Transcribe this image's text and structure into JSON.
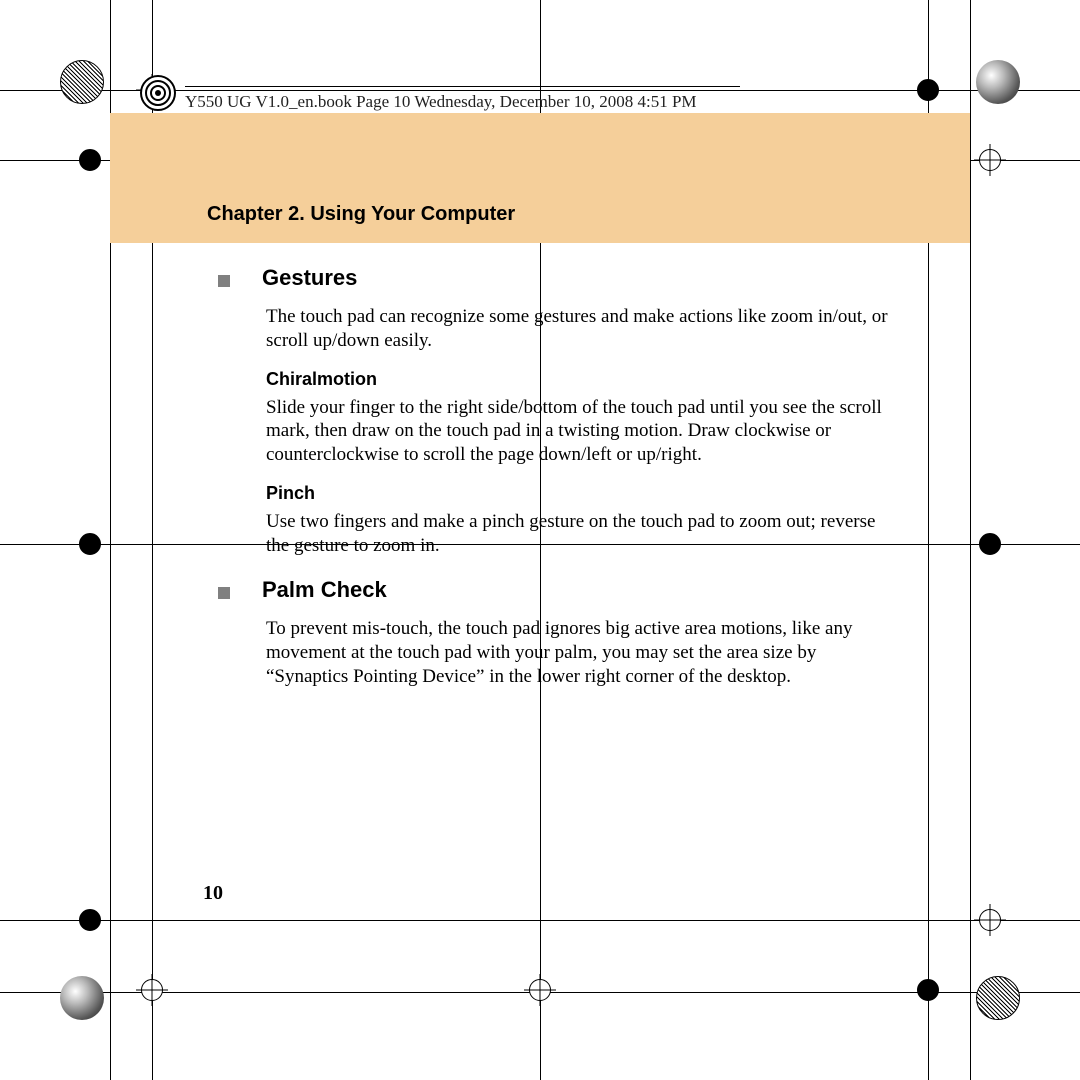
{
  "slip": "Y550 UG V1.0_en.book  Page 10  Wednesday, December 10, 2008  4:51 PM",
  "banner_title": "Chapter 2. Using Your Computer",
  "sections": {
    "gestures": {
      "title": "Gestures",
      "intro": "The touch pad can recognize some gestures and make actions like zoom in/out, or scroll up/down easily.",
      "sub1_title": "Chiralmotion",
      "sub1_body": "Slide your finger to the right side/bottom of the touch pad until you see the scroll mark, then draw on the touch pad in a twisting motion. Draw clockwise or counterclockwise to scroll the page down/left or up/right.",
      "sub2_title": "Pinch",
      "sub2_body": "Use two fingers and make a pinch gesture on the touch pad to zoom out; reverse the gesture to zoom in."
    },
    "palmcheck": {
      "title": "Palm Check",
      "body": "To prevent mis-touch, the touch pad ignores big active area motions, like any movement at the touch pad with your palm, you may set the area size by “Synaptics Pointing Device” in the lower right corner of the desktop."
    }
  },
  "page_number": "10"
}
